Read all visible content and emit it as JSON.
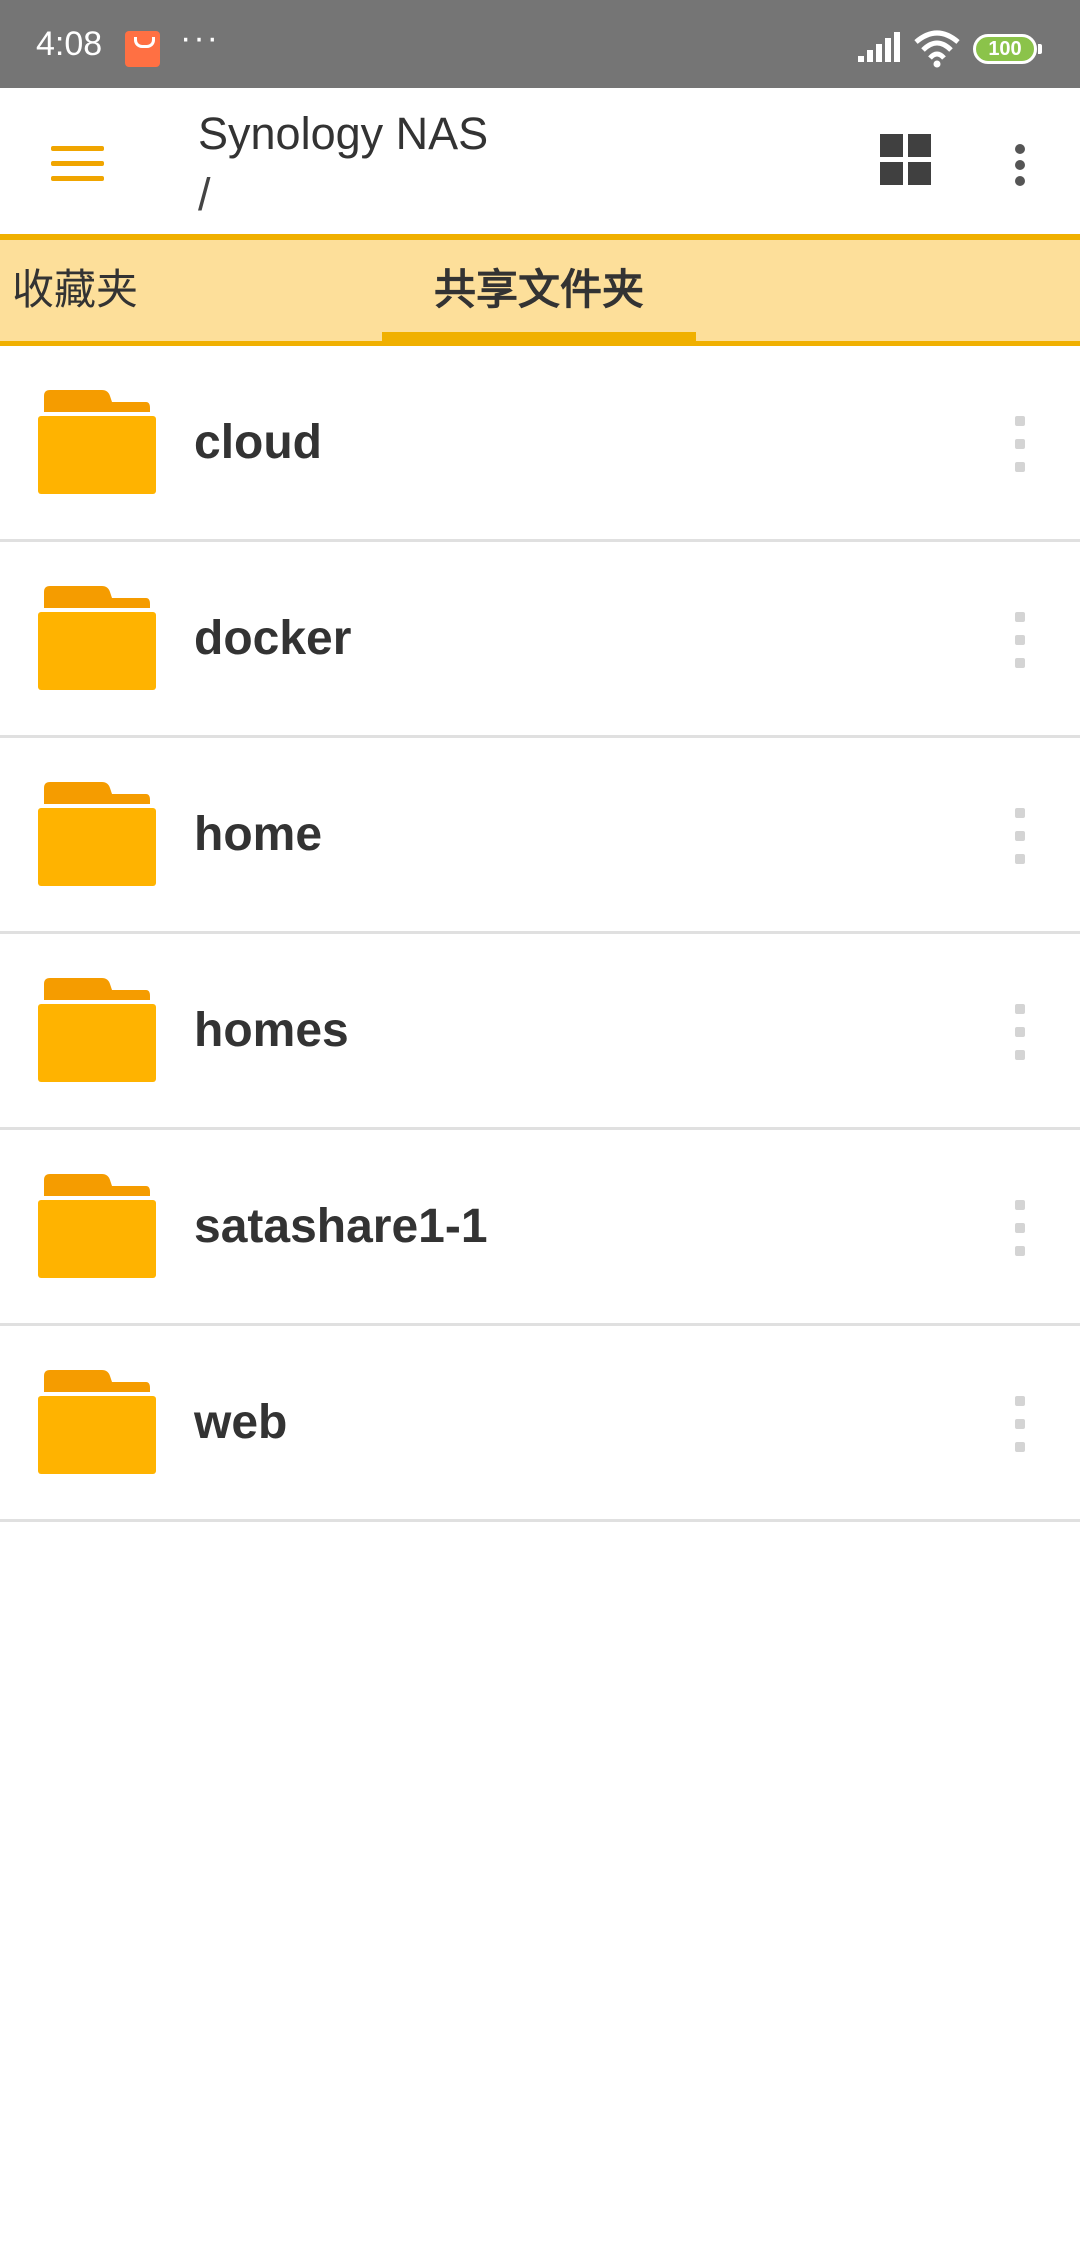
{
  "status_bar": {
    "time": "4:08",
    "more_dots": "···",
    "battery": "100"
  },
  "app_bar": {
    "title": "Synology NAS",
    "path": "/"
  },
  "tabs": [
    {
      "label": "收藏夹",
      "selected": false
    },
    {
      "label": "共享文件夹",
      "selected": true
    }
  ],
  "folders": [
    {
      "name": "cloud"
    },
    {
      "name": "docker"
    },
    {
      "name": "home"
    },
    {
      "name": "homes"
    },
    {
      "name": "satashare1-1"
    },
    {
      "name": "web"
    }
  ],
  "colors": {
    "accent": "#f0b000",
    "folder": "#ffb300",
    "tab_background": "#fddf9a",
    "status_bar": "#757575"
  },
  "icons": {
    "menu": "menu-icon",
    "grid": "grid-view-icon",
    "more": "more-vert-icon",
    "folder": "folder-icon"
  }
}
